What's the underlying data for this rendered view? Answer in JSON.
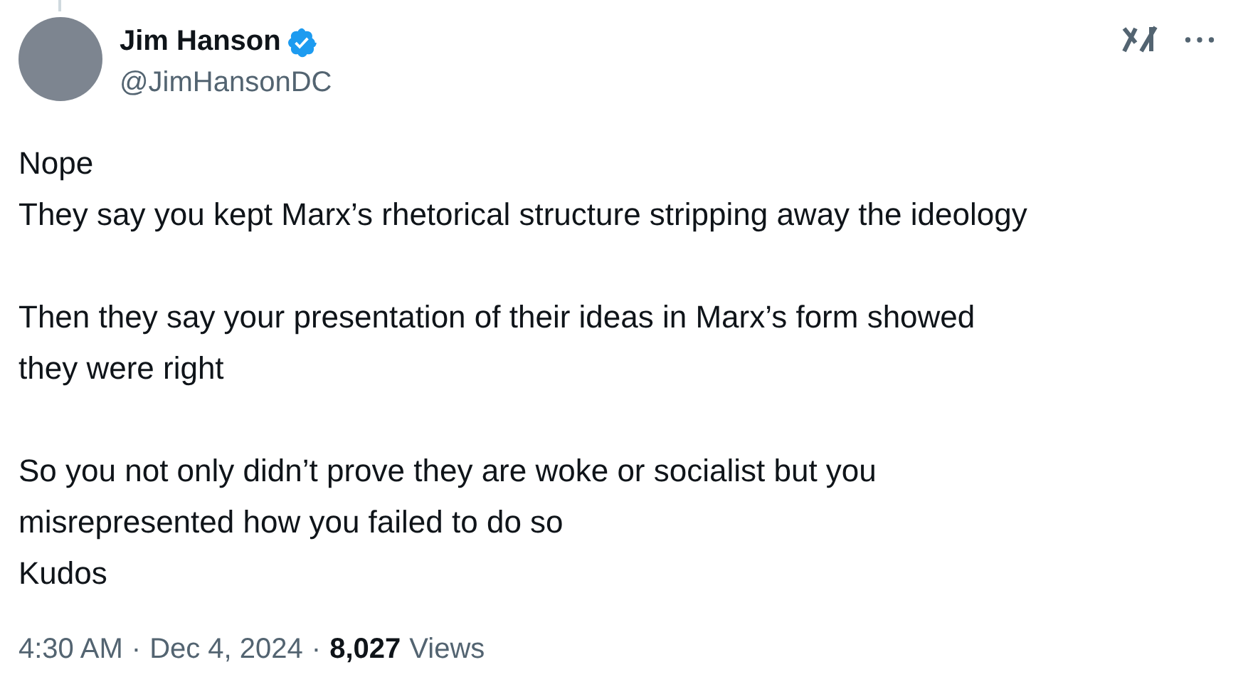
{
  "author": {
    "name": "Jim Hanson",
    "verified": true,
    "handle": "@JimHansonDC"
  },
  "body": "Nope\nThey say you kept Marx’s rhetorical structure stripping away the ideology\n\nThen they say your presentation of their ideas in Marx’s form showed\nthey were right\n\nSo you not only didn’t prove they are woke or socialist but you\nmisrepresented how you failed to do so\nKudos",
  "meta": {
    "time": "4:30 AM",
    "separator_1": "·",
    "date": "Dec 4, 2024",
    "separator_2": "·",
    "views_count": "8,027",
    "views_label": "Views"
  }
}
